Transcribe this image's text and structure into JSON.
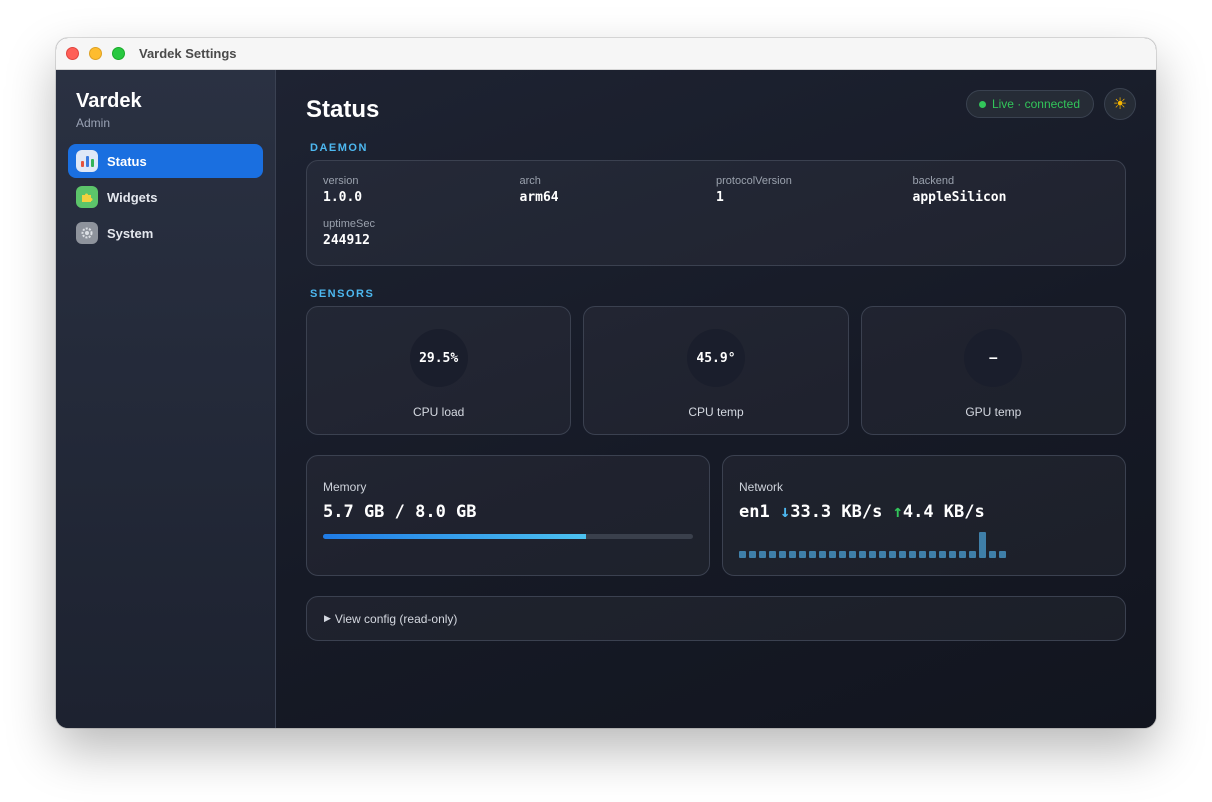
{
  "window": {
    "title": "Vardek Settings"
  },
  "sidebar": {
    "brand": "Vardek",
    "role": "Admin",
    "items": [
      {
        "label": "Status",
        "icon": "bar-chart-icon",
        "active": true
      },
      {
        "label": "Widgets",
        "icon": "puzzle-icon",
        "active": false
      },
      {
        "label": "System",
        "icon": "gear-icon",
        "active": false
      }
    ]
  },
  "header": {
    "title": "Status",
    "live_status": "Live · connected",
    "theme_icon": "sun-icon"
  },
  "daemon": {
    "label": "DAEMON",
    "fields": [
      {
        "key": "version",
        "value": "1.0.0"
      },
      {
        "key": "arch",
        "value": "arm64"
      },
      {
        "key": "protocolVersion",
        "value": "1"
      },
      {
        "key": "backend",
        "value": "appleSilicon"
      },
      {
        "key": "uptimeSec",
        "value": "244912"
      }
    ]
  },
  "sensors": {
    "label": "SENSORS",
    "items": [
      {
        "value": "29.5%",
        "name": "CPU load"
      },
      {
        "value": "45.9°",
        "name": "CPU temp"
      },
      {
        "value": "–",
        "name": "GPU temp"
      }
    ]
  },
  "memory": {
    "label": "Memory",
    "value": "5.7 GB / 8.0 GB",
    "used_fraction": 0.712
  },
  "network": {
    "label": "Network",
    "interface": "en1",
    "down_arrow": "↓",
    "down": "33.3 KB/s",
    "up_arrow": "↑",
    "up": "4.4 KB/s",
    "history": [
      1,
      1,
      1,
      1,
      1.1,
      1,
      1,
      1,
      1,
      1,
      1,
      1,
      1.1,
      1,
      1,
      1,
      1,
      1,
      1,
      1,
      1,
      1,
      1.1,
      1,
      3.9,
      1,
      1
    ]
  },
  "config": {
    "toggle": "▶",
    "label": "View config (read-only)"
  },
  "colors": {
    "accent": "#1a6fe0",
    "live_green": "#32c55a",
    "section_blue": "#4db8f0"
  }
}
